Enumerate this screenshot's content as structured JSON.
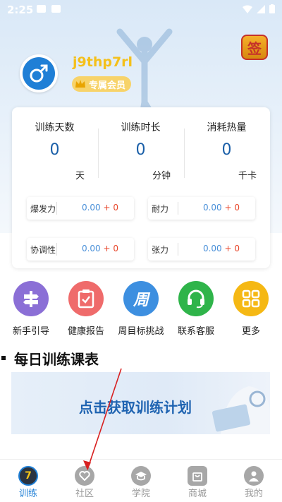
{
  "status_bar": {
    "time": "2:25"
  },
  "header": {
    "username": "j9thp7rl",
    "vip_label": "专属会员",
    "sign_label": "签"
  },
  "stats": [
    {
      "label": "训练天数",
      "value": "0",
      "unit": "天"
    },
    {
      "label": "训练时长",
      "value": "0",
      "unit": "分钟"
    },
    {
      "label": "消耗热量",
      "value": "0",
      "unit": "千卡"
    }
  ],
  "metrics": [
    {
      "label": "爆发力",
      "base": "0.00",
      "delta": "+ 0"
    },
    {
      "label": "耐力",
      "base": "0.00",
      "delta": "+ 0"
    },
    {
      "label": "协调性",
      "base": "0.00",
      "delta": "+ 0"
    },
    {
      "label": "张力",
      "base": "0.00",
      "delta": "+ 0"
    }
  ],
  "shortcuts": [
    {
      "label": "新手引导",
      "icon": "signpost-icon",
      "color": "#8b6fd6"
    },
    {
      "label": "健康报告",
      "icon": "clipboard-check-icon",
      "color": "#ef6b6b"
    },
    {
      "label": "周目标挑战",
      "icon": "week-icon",
      "glyph": "周",
      "color": "#3d8fe0"
    },
    {
      "label": "联系客服",
      "icon": "headset-icon",
      "color": "#2fb44a"
    },
    {
      "label": "更多",
      "icon": "grid-icon",
      "color": "#f5b814"
    }
  ],
  "daily_section": {
    "title": "每日训练课表"
  },
  "plan_banner": {
    "text": "点击获取训练计划"
  },
  "tabs": [
    {
      "label": "训练",
      "icon": "training-icon",
      "active": true
    },
    {
      "label": "社区",
      "icon": "heart-chat-icon",
      "active": false
    },
    {
      "label": "学院",
      "icon": "graduation-cap-icon",
      "active": false
    },
    {
      "label": "商城",
      "icon": "shop-bag-icon",
      "active": false
    },
    {
      "label": "我的",
      "icon": "user-icon",
      "active": false
    }
  ],
  "colors": {
    "accent": "#1f7fd6",
    "stat_value": "#1a5fa8",
    "metric_base": "#4a90d9",
    "metric_delta": "#e8462a",
    "username": "#f4c01a",
    "annotation_arrow": "#d82020"
  }
}
